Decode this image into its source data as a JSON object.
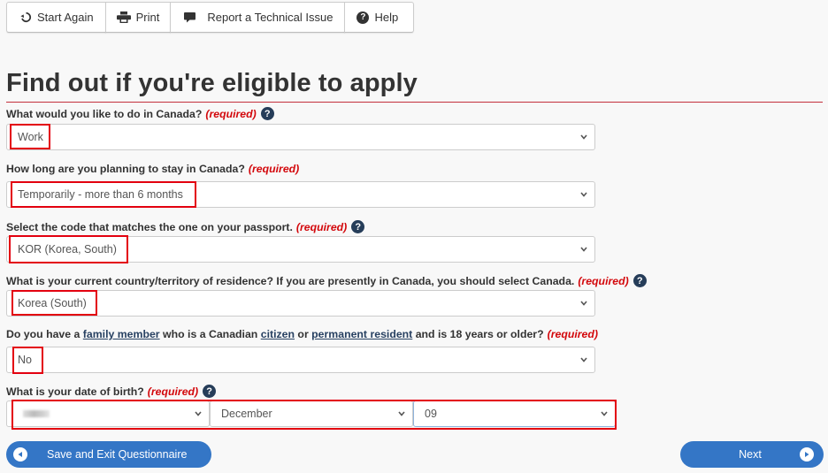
{
  "toolbar": {
    "start_again": {
      "label": "Start Again",
      "icon": "refresh-icon"
    },
    "print": {
      "label": "Print",
      "icon": "print-icon"
    },
    "report": {
      "label": "Report a Technical Issue",
      "icon": "comment-icon"
    },
    "help": {
      "label": "Help",
      "icon": "question-circle-icon"
    }
  },
  "page": {
    "title": "Find out if you're eligible to apply",
    "required_text": "(required)"
  },
  "questions": [
    {
      "label": "What would you like to do in Canada?",
      "required": "(required)",
      "help": true,
      "value": "Work"
    },
    {
      "label": "How long are you planning to stay in Canada?",
      "required": "(required)",
      "help": false,
      "value": "Temporarily - more than 6 months"
    },
    {
      "label": "Select the code that matches the one on your passport.",
      "required": "(required)",
      "help": true,
      "value": "KOR (Korea, South)"
    },
    {
      "label": "What is your current country/territory of residence? If you are presently in Canada, you should select Canada.",
      "required": "(required)",
      "help": true,
      "value": "Korea (South)"
    },
    {
      "label_parts": {
        "p1": "Do you have a ",
        "link1": "family member",
        "p2": " who is a Canadian ",
        "link2": "citizen",
        "p3": " or ",
        "link3": "permanent resident",
        "p4": " and is 18 years or older?"
      },
      "required": "(required)",
      "help": false,
      "value": "No"
    },
    {
      "label": "What is your date of birth?",
      "required": "(required)",
      "help": true,
      "year": "",
      "month": "December",
      "day": "09"
    }
  ],
  "buttons": {
    "save_exit": "Save and Exit Questionnaire",
    "next": "Next"
  },
  "colors": {
    "accent": "#3476c6",
    "required": "#d3080c",
    "highlight": "#e3000f",
    "rule": "#c3303d"
  }
}
